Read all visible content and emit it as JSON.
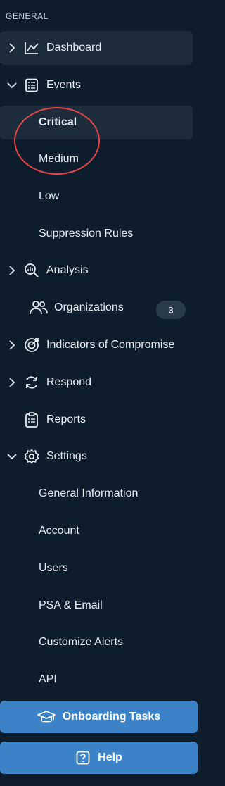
{
  "nav": {
    "section_label": "GENERAL",
    "dashboard": "Dashboard",
    "events": "Events",
    "events_children": {
      "critical": "Critical",
      "medium": "Medium",
      "low": "Low",
      "suppression_rules": "Suppression Rules"
    },
    "analysis": "Analysis",
    "organizations": "Organizations",
    "organizations_badge": "3",
    "ioc": "Indicators of Compromise",
    "respond": "Respond",
    "reports": "Reports",
    "settings": "Settings",
    "settings_children": {
      "general_information": "General Information",
      "account": "Account",
      "users": "Users",
      "psa_email": "PSA & Email",
      "customize_alerts": "Customize Alerts",
      "api": "API"
    }
  },
  "buttons": {
    "onboarding": "Onboarding Tasks",
    "help": "Help"
  },
  "colors": {
    "background": "#0e1d2c",
    "highlight": "#1c2c3b",
    "button": "#3b83c6",
    "annotation_circle": "#e0464a"
  },
  "icons": {
    "dashboard": "line-chart-icon",
    "events": "checklist-icon",
    "analysis": "magnifier-chart-icon",
    "organizations": "users-icon",
    "ioc": "target-icon",
    "respond": "refresh-icon",
    "reports": "clipboard-icon",
    "settings": "gear-icon",
    "onboarding": "graduation-cap-icon",
    "help": "question-box-icon"
  }
}
